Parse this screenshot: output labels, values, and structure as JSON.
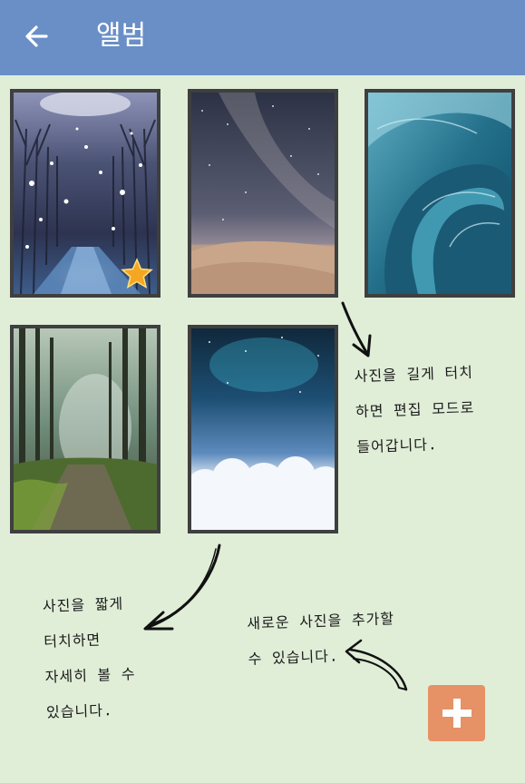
{
  "header": {
    "title": "앨범",
    "back_icon": "arrow-left-icon"
  },
  "photos": [
    {
      "subject": "snowy tree-lined street at night",
      "favorite": true
    },
    {
      "subject": "milky way over desert dunes",
      "favorite": false
    },
    {
      "subject": "curling ocean wave",
      "favorite": false
    },
    {
      "subject": "forest path",
      "favorite": false
    },
    {
      "subject": "starry sky above clouds",
      "favorite": false
    }
  ],
  "hints": {
    "long_press": "사진을 길게 터치\n하면 편집 모드로\n들어갑니다.",
    "short_tap": "사진을 짧게\n터치하면\n자세히 볼 수\n있습니다.",
    "add_photo": "새로운 사진을 추가할\n수 있습니다."
  },
  "fab": {
    "icon": "plus-icon",
    "color": "#e69266"
  },
  "colors": {
    "appbar": "#698fc6",
    "background": "#e0eed8",
    "frame": "#3f3f3f"
  }
}
